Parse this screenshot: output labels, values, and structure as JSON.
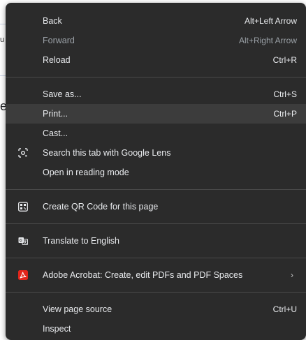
{
  "background": {
    "fragment_u": "u",
    "fragment_e": "e"
  },
  "menu": {
    "back": {
      "label": "Back",
      "shortcut": "Alt+Left Arrow"
    },
    "forward": {
      "label": "Forward",
      "shortcut": "Alt+Right Arrow"
    },
    "reload": {
      "label": "Reload",
      "shortcut": "Ctrl+R"
    },
    "save_as": {
      "label": "Save as...",
      "shortcut": "Ctrl+S"
    },
    "print": {
      "label": "Print...",
      "shortcut": "Ctrl+P"
    },
    "cast": {
      "label": "Cast..."
    },
    "google_lens": {
      "label": "Search this tab with Google Lens",
      "icon": "google-lens-icon"
    },
    "reading_mode": {
      "label": "Open in reading mode"
    },
    "qr_code": {
      "label": "Create QR Code for this page",
      "icon": "qr-code-icon"
    },
    "translate": {
      "label": "Translate to English",
      "icon": "translate-icon"
    },
    "acrobat": {
      "label": "Adobe Acrobat: Create, edit PDFs and PDF Spaces",
      "icon": "adobe-acrobat-icon",
      "chevron": "›"
    },
    "view_source": {
      "label": "View page source",
      "shortcut": "Ctrl+U"
    },
    "inspect": {
      "label": "Inspect"
    }
  },
  "colors": {
    "menu_bg": "#2b2b2b",
    "highlight_bg": "#3c3c3c",
    "text": "#e8eaed",
    "disabled_text": "#9aa0a6",
    "acrobat_red": "#e3251b"
  }
}
